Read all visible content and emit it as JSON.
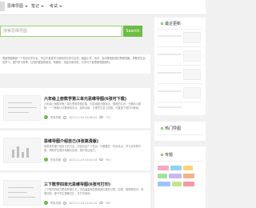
{
  "nav": {
    "items": [
      {
        "label": "思维导图"
      },
      {
        "label": "笔记"
      },
      {
        "label": "考试"
      }
    ]
  },
  "search": {
    "placeholder": "搜索思维导图",
    "button_label": "Search"
  },
  "intro": {
    "text": "思维导图网是一个知识分享平台，专注于各类学习资料的分享与交流，涵盖小学、初中、高中等各阶段的思维导图，帮助学生高效学习，提升学习效率，让知识更加系统化、条理化，欢迎大家浏览、分享与下载思维导图资料。"
  },
  "articles": [
    {
      "title": "六年级上册数学第三单元思维导图(6张可下载)",
      "desc": "六年级上册数学第三单元思维导图合集，内容涵盖分数除法、倒数的认识、分数除以整数、一个数除以分数等知识点，结构清晰，方便学生复习巩固，可直接下载打印使用。",
      "author": "思维导图",
      "date": "2023-11-03 00:06:04",
      "views": "775"
    },
    {
      "title": "思维导图介绍自己(8张高清版)",
      "desc": "用思维导图介绍自己的方法，内容包括个人信息、兴趣爱好、特长优点、学习目标等方面，帮助学生更好地展示自我，提升表达能力。",
      "author": "思维导图",
      "date": "2023-11-03 00:04:34",
      "views": "951"
    },
    {
      "title": "三下数学四单元思维导图(6张可打印)",
      "desc": "三下数学四单元思维导图汇总，内容涵盖两位数乘两位数的口算、估算、笔算等知识，条理清晰，便于学生理解记忆，可打印使用。",
      "author": "思维导图",
      "date": "2023-11-03 00:01:54",
      "views": "983"
    }
  ],
  "sidebar": {
    "sections": [
      {
        "title": "最近更新"
      },
      {
        "title": "热门导图"
      },
      {
        "title": "专题"
      }
    ]
  },
  "colors": {
    "accent": "#6cbd45",
    "tags": [
      "#f6a9c1",
      "#8fd3f0",
      "#ffd27a",
      "#a8e0a0",
      "#c9b6f2",
      "#f4b183",
      "#9ec5f8",
      "#c5e48a",
      "#f59aa0"
    ]
  }
}
